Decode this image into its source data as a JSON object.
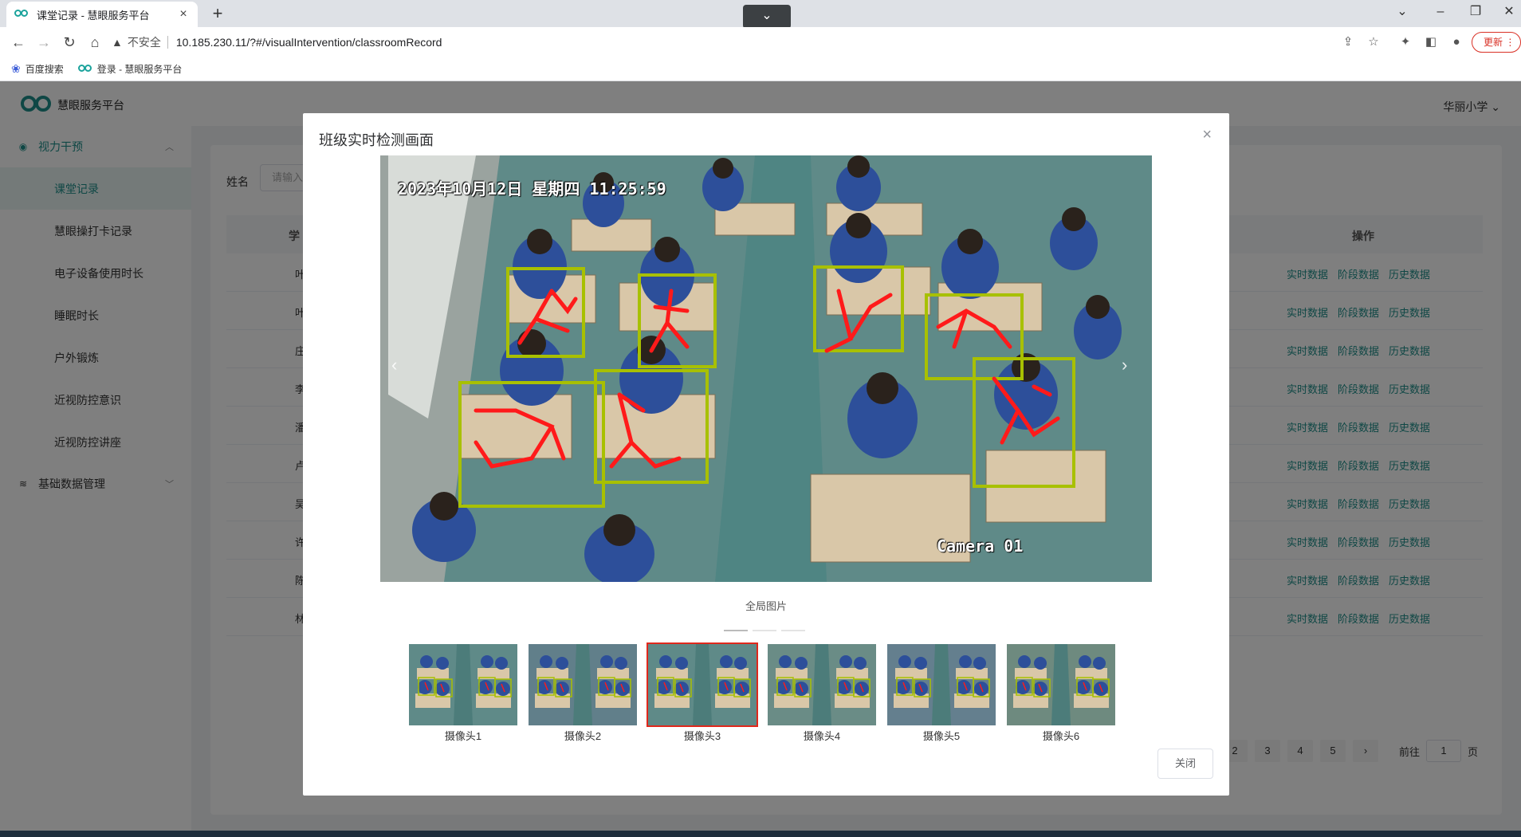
{
  "browser": {
    "tab_title": "课堂记录 - 慧眼服务平台",
    "tab_close": "×",
    "new_tab": "+",
    "url": "10.185.230.11/?#/visualIntervention/classroomRecord",
    "insecure_label": "不安全",
    "update_label": "更新",
    "bookmarks": [
      {
        "label": "百度搜索",
        "icon": "paw-icon"
      },
      {
        "label": "登录 - 慧眼服务平台",
        "icon": "huiyan-logo-icon"
      }
    ]
  },
  "app": {
    "title": "慧眼服务平台",
    "school": "华丽小学",
    "sidebar": {
      "group1": "视力干预",
      "items": [
        "课堂记录",
        "慧眼操打卡记录",
        "电子设备使用时长",
        "睡眠时长",
        "户外锻炼",
        "近视防控意识",
        "近视防控讲座"
      ],
      "group2": "基础数据管理"
    },
    "filter": {
      "label": "姓名",
      "placeholder": "请输入"
    },
    "table": {
      "header_first": "学",
      "header_ops": "操作",
      "rows": [
        "叶",
        "叶",
        "庄",
        "李",
        "潘",
        "卢",
        "吴",
        "许",
        "陈",
        "林"
      ],
      "ops": [
        "实时数据",
        "阶段数据",
        "历史数据"
      ]
    },
    "pager": {
      "pages": [
        "2",
        "3",
        "4",
        "5",
        "›"
      ],
      "goto_label": "前往",
      "goto_value": "1",
      "page_suffix": "页"
    }
  },
  "modal": {
    "title": "班级实时检测画面",
    "close_x": "×",
    "stamp": "2023年10月12日  星期四  11:25:59",
    "camera_label": "Camera 01",
    "caption": "全局图片",
    "thumbnails": [
      "摄像头1",
      "摄像头2",
      "摄像头3",
      "摄像头4",
      "摄像头5",
      "摄像头6"
    ],
    "selected_thumbnail": "摄像头3",
    "close_button": "关闭"
  },
  "colors": {
    "accent": "#1e8f8a",
    "detection_box": "#a8c000",
    "skeleton": "#ff1a1a",
    "selected_border": "#e0281c"
  }
}
